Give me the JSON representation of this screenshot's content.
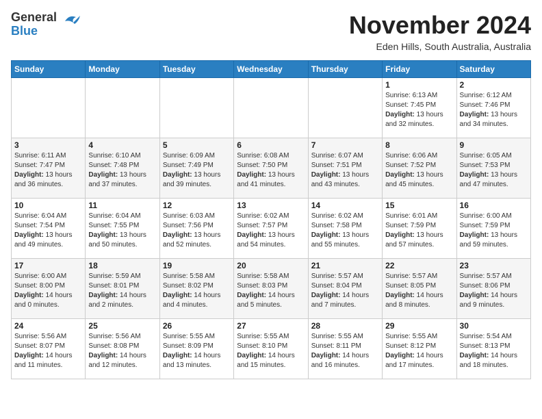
{
  "header": {
    "logo_general": "General",
    "logo_blue": "Blue",
    "month": "November 2024",
    "location": "Eden Hills, South Australia, Australia"
  },
  "days_of_week": [
    "Sunday",
    "Monday",
    "Tuesday",
    "Wednesday",
    "Thursday",
    "Friday",
    "Saturday"
  ],
  "weeks": [
    [
      {
        "day": "",
        "info": ""
      },
      {
        "day": "",
        "info": ""
      },
      {
        "day": "",
        "info": ""
      },
      {
        "day": "",
        "info": ""
      },
      {
        "day": "",
        "info": ""
      },
      {
        "day": "1",
        "info": "Sunrise: 6:13 AM\nSunset: 7:45 PM\nDaylight: 13 hours\nand 32 minutes."
      },
      {
        "day": "2",
        "info": "Sunrise: 6:12 AM\nSunset: 7:46 PM\nDaylight: 13 hours\nand 34 minutes."
      }
    ],
    [
      {
        "day": "3",
        "info": "Sunrise: 6:11 AM\nSunset: 7:47 PM\nDaylight: 13 hours\nand 36 minutes."
      },
      {
        "day": "4",
        "info": "Sunrise: 6:10 AM\nSunset: 7:48 PM\nDaylight: 13 hours\nand 37 minutes."
      },
      {
        "day": "5",
        "info": "Sunrise: 6:09 AM\nSunset: 7:49 PM\nDaylight: 13 hours\nand 39 minutes."
      },
      {
        "day": "6",
        "info": "Sunrise: 6:08 AM\nSunset: 7:50 PM\nDaylight: 13 hours\nand 41 minutes."
      },
      {
        "day": "7",
        "info": "Sunrise: 6:07 AM\nSunset: 7:51 PM\nDaylight: 13 hours\nand 43 minutes."
      },
      {
        "day": "8",
        "info": "Sunrise: 6:06 AM\nSunset: 7:52 PM\nDaylight: 13 hours\nand 45 minutes."
      },
      {
        "day": "9",
        "info": "Sunrise: 6:05 AM\nSunset: 7:53 PM\nDaylight: 13 hours\nand 47 minutes."
      }
    ],
    [
      {
        "day": "10",
        "info": "Sunrise: 6:04 AM\nSunset: 7:54 PM\nDaylight: 13 hours\nand 49 minutes."
      },
      {
        "day": "11",
        "info": "Sunrise: 6:04 AM\nSunset: 7:55 PM\nDaylight: 13 hours\nand 50 minutes."
      },
      {
        "day": "12",
        "info": "Sunrise: 6:03 AM\nSunset: 7:56 PM\nDaylight: 13 hours\nand 52 minutes."
      },
      {
        "day": "13",
        "info": "Sunrise: 6:02 AM\nSunset: 7:57 PM\nDaylight: 13 hours\nand 54 minutes."
      },
      {
        "day": "14",
        "info": "Sunrise: 6:02 AM\nSunset: 7:58 PM\nDaylight: 13 hours\nand 55 minutes."
      },
      {
        "day": "15",
        "info": "Sunrise: 6:01 AM\nSunset: 7:59 PM\nDaylight: 13 hours\nand 57 minutes."
      },
      {
        "day": "16",
        "info": "Sunrise: 6:00 AM\nSunset: 7:59 PM\nDaylight: 13 hours\nand 59 minutes."
      }
    ],
    [
      {
        "day": "17",
        "info": "Sunrise: 6:00 AM\nSunset: 8:00 PM\nDaylight: 14 hours\nand 0 minutes."
      },
      {
        "day": "18",
        "info": "Sunrise: 5:59 AM\nSunset: 8:01 PM\nDaylight: 14 hours\nand 2 minutes."
      },
      {
        "day": "19",
        "info": "Sunrise: 5:58 AM\nSunset: 8:02 PM\nDaylight: 14 hours\nand 4 minutes."
      },
      {
        "day": "20",
        "info": "Sunrise: 5:58 AM\nSunset: 8:03 PM\nDaylight: 14 hours\nand 5 minutes."
      },
      {
        "day": "21",
        "info": "Sunrise: 5:57 AM\nSunset: 8:04 PM\nDaylight: 14 hours\nand 7 minutes."
      },
      {
        "day": "22",
        "info": "Sunrise: 5:57 AM\nSunset: 8:05 PM\nDaylight: 14 hours\nand 8 minutes."
      },
      {
        "day": "23",
        "info": "Sunrise: 5:57 AM\nSunset: 8:06 PM\nDaylight: 14 hours\nand 9 minutes."
      }
    ],
    [
      {
        "day": "24",
        "info": "Sunrise: 5:56 AM\nSunset: 8:07 PM\nDaylight: 14 hours\nand 11 minutes."
      },
      {
        "day": "25",
        "info": "Sunrise: 5:56 AM\nSunset: 8:08 PM\nDaylight: 14 hours\nand 12 minutes."
      },
      {
        "day": "26",
        "info": "Sunrise: 5:55 AM\nSunset: 8:09 PM\nDaylight: 14 hours\nand 13 minutes."
      },
      {
        "day": "27",
        "info": "Sunrise: 5:55 AM\nSunset: 8:10 PM\nDaylight: 14 hours\nand 15 minutes."
      },
      {
        "day": "28",
        "info": "Sunrise: 5:55 AM\nSunset: 8:11 PM\nDaylight: 14 hours\nand 16 minutes."
      },
      {
        "day": "29",
        "info": "Sunrise: 5:55 AM\nSunset: 8:12 PM\nDaylight: 14 hours\nand 17 minutes."
      },
      {
        "day": "30",
        "info": "Sunrise: 5:54 AM\nSunset: 8:13 PM\nDaylight: 14 hours\nand 18 minutes."
      }
    ]
  ]
}
